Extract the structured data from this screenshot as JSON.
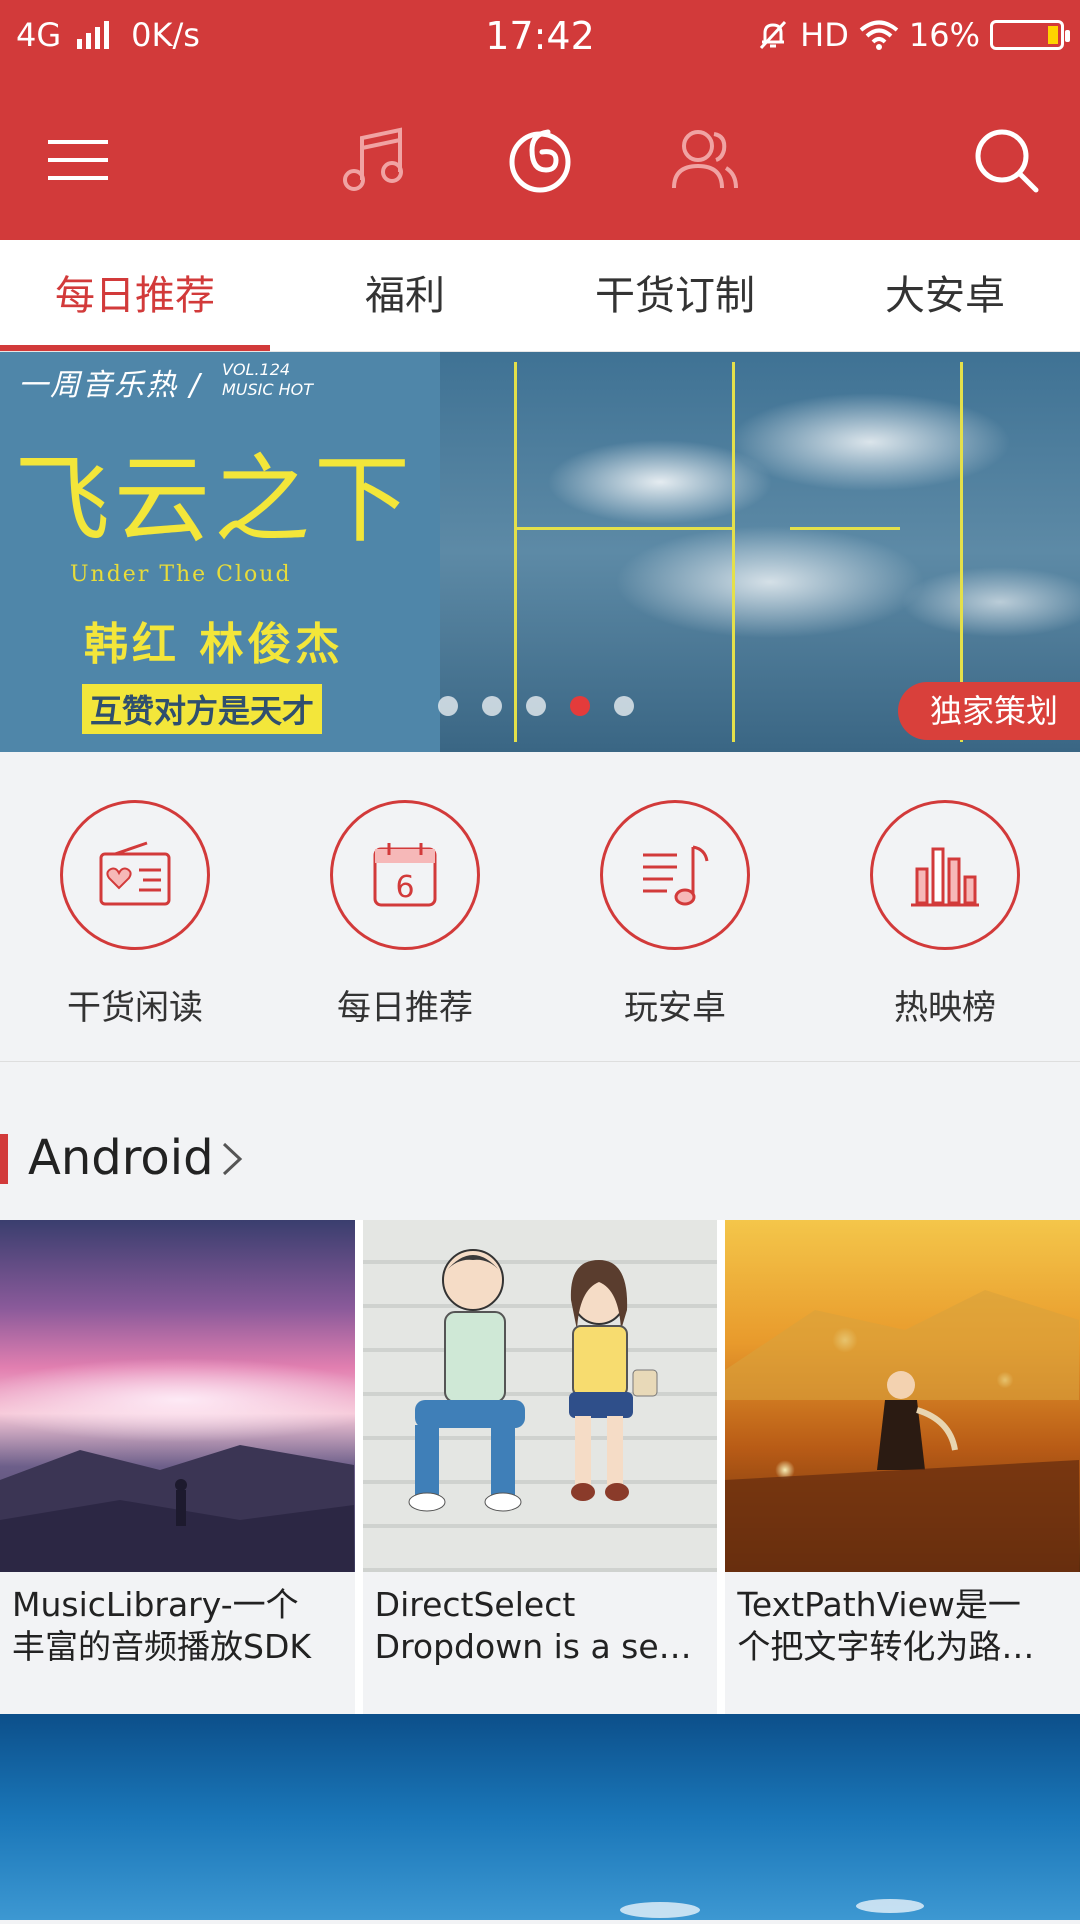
{
  "status_bar": {
    "network": "4G",
    "speed": "0K/s",
    "time": "17:42",
    "hd": "HD",
    "battery": "16%"
  },
  "toolbar": {
    "icons": [
      "menu-icon",
      "music-note-icon",
      "netease-logo-icon",
      "friends-icon",
      "search-icon"
    ]
  },
  "tabs": [
    {
      "label": "每日推荐",
      "active": true
    },
    {
      "label": "福利",
      "active": false
    },
    {
      "label": "干货订制",
      "active": false
    },
    {
      "label": "大安卓",
      "active": false
    }
  ],
  "banner": {
    "weekly": "一周音乐热 /",
    "vol": "VOL.124",
    "music_hot": "MUSIC HOT",
    "title": "飞云之下",
    "subtitle_en": "Under The Cloud",
    "artists": "韩红  林俊杰",
    "slogan": "互赞对方是天才",
    "tag": "独家策划",
    "page_count": 5,
    "active_page": 4
  },
  "shortcuts": [
    {
      "label": "干货闲读",
      "icon": "radio-heart-icon"
    },
    {
      "label": "每日推荐",
      "icon": "calendar-icon",
      "day": "6"
    },
    {
      "label": "玩安卓",
      "icon": "playlist-icon"
    },
    {
      "label": "热映榜",
      "icon": "bar-chart-icon"
    }
  ],
  "section": {
    "title": "Android"
  },
  "cards": [
    {
      "line1": "MusicLibrary-一个",
      "line2": "丰富的音频播放SDK"
    },
    {
      "line1": "DirectSelect",
      "line2": "Dropdown is a se…"
    },
    {
      "line1": "TextPathView是一",
      "line2": "个把文字转化为路…"
    }
  ],
  "colors": {
    "primary": "#d23a3a",
    "accent_yellow": "#f3e63a",
    "background": "#f2f3f5"
  }
}
